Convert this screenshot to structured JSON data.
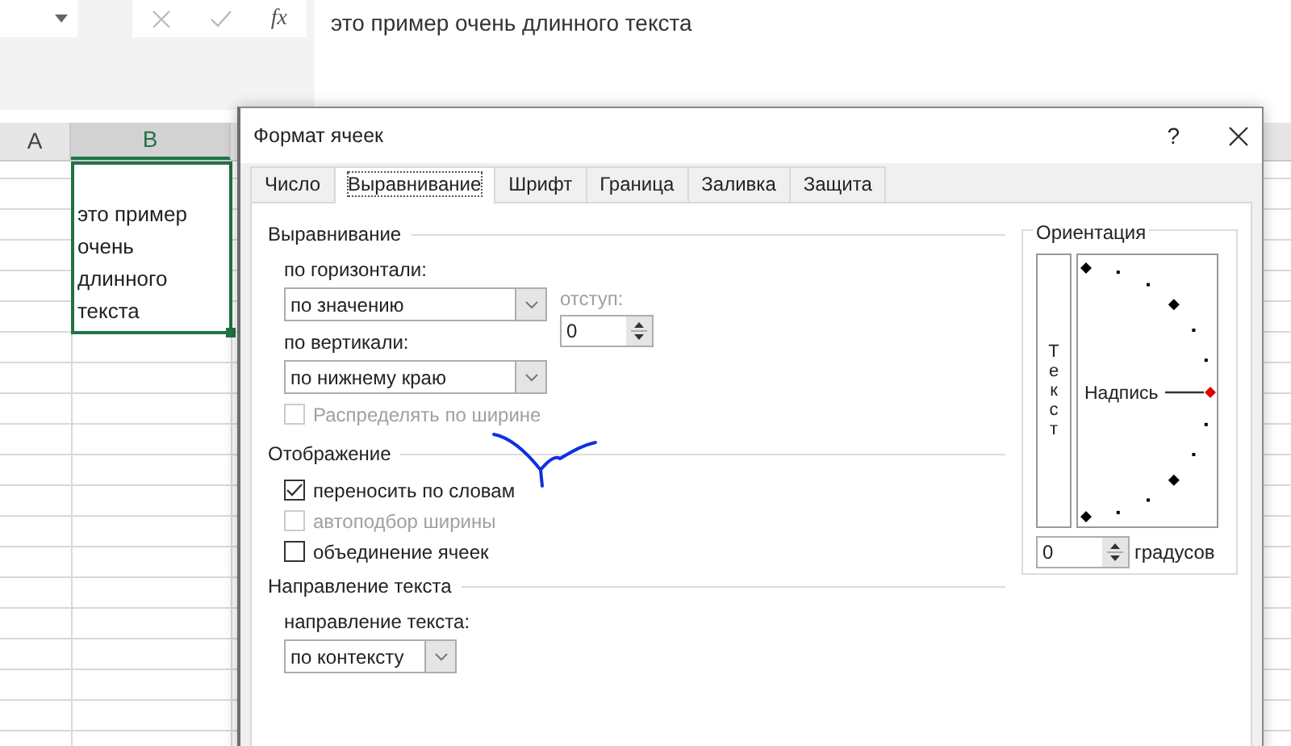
{
  "formula_bar": {
    "function_label": "fx",
    "value": "это пример очень длинного текста"
  },
  "sheet": {
    "columns": [
      {
        "label": "A",
        "selected": false
      },
      {
        "label": "B",
        "selected": true
      }
    ],
    "active_cell": {
      "text": "это пример очень длинного текста"
    }
  },
  "dialog": {
    "title": "Формат ячеек",
    "help": "?",
    "tabs": [
      {
        "label": "Число",
        "selected": false
      },
      {
        "label": "Выравнивание",
        "selected": true
      },
      {
        "label": "Шрифт",
        "selected": false
      },
      {
        "label": "Граница",
        "selected": false
      },
      {
        "label": "Заливка",
        "selected": false
      },
      {
        "label": "Защита",
        "selected": false
      }
    ],
    "alignment": {
      "title": "Выравнивание",
      "horizontal": {
        "label": "по горизонтали:",
        "value": "по значению"
      },
      "indent": {
        "label": "отступ:",
        "value": "0",
        "disabled": true
      },
      "vertical": {
        "label": "по вертикали:",
        "value": "по нижнему краю"
      },
      "distribute": {
        "label": "Распределять по ширине",
        "checked": false,
        "disabled": true
      }
    },
    "display": {
      "title": "Отображение",
      "options": [
        {
          "label": "переносить по словам",
          "checked": true,
          "disabled": false
        },
        {
          "label": "автоподбор ширины",
          "checked": false,
          "disabled": true
        },
        {
          "label": "объединение ячеек",
          "checked": false,
          "disabled": false
        }
      ]
    },
    "direction": {
      "title": "Направление текста",
      "label": "направление текста:",
      "value": "по контексту"
    },
    "orientation": {
      "title": "Ориентация",
      "vertical_text": "Текст",
      "dial_label": "Надпись",
      "degrees_value": "0",
      "degrees_label": "градусов"
    }
  }
}
